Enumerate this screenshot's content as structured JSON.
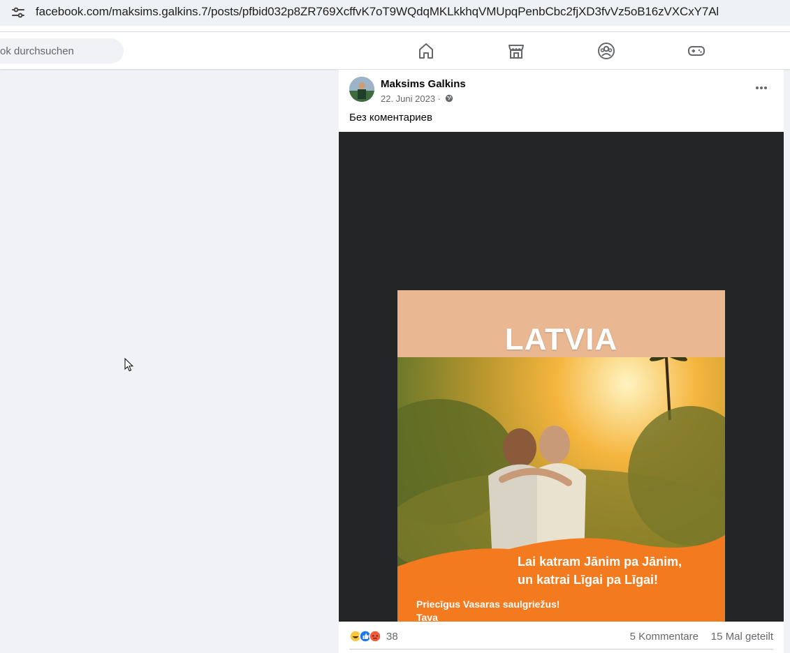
{
  "browser": {
    "url": "facebook.com/maksims.galkins.7/posts/pfbid032p8ZR769XcffvK7oT9WQdqMKLkkhqVMUpqPenbCbc2fjXD3fvVz5oB16zVXCxY7Al"
  },
  "header": {
    "search_placeholder": "ok durchsuchen",
    "nav_icons": [
      "home-icon",
      "marketplace-icon",
      "groups-icon",
      "gaming-icon"
    ]
  },
  "post": {
    "author": "Maksims Galkins",
    "date": "22. Juni 2023 ·",
    "text": "Без коментариев",
    "image": {
      "title": "LATVIA",
      "caption_line1": "Lai katram Jānim pa Jānim,",
      "caption_line2": "un katrai Līgai pa Līgai!",
      "footer_line1": "Priecīgus Vasaras saulgriežus!",
      "footer_line2": "Tava"
    },
    "reactions": {
      "icons": [
        "haha-icon",
        "like-icon",
        "angry-icon"
      ],
      "count": "38"
    },
    "comments": "5 Kommentare",
    "shares": "15 Mal geteilt"
  },
  "colors": {
    "page_bg": "#f0f2f5",
    "media_bg": "#242526",
    "orange_band": "#f47a1f",
    "like_blue": "#1877f2"
  }
}
